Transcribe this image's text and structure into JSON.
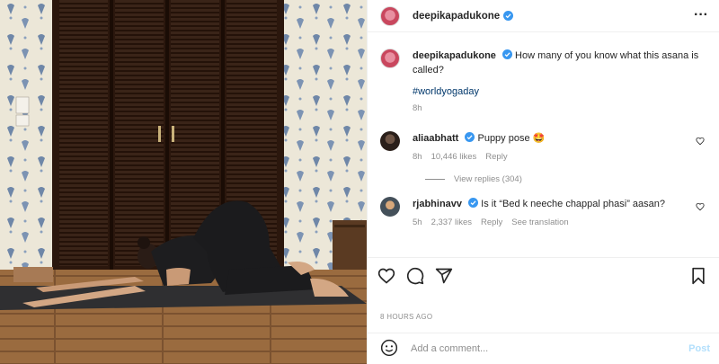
{
  "header": {
    "username": "deepikapadukone",
    "more_icon": "more-horizontal-icon"
  },
  "caption": {
    "username": "deepikapadukone",
    "text": "How many of you know what this asana is called?",
    "hashtag": "#worldyogaday",
    "time": "8h"
  },
  "comments": [
    {
      "username": "aliaabhatt",
      "text": "Puppy pose 🤩",
      "time": "8h",
      "likes": "10,446 likes",
      "reply": "Reply",
      "view_replies": "View replies (304)"
    },
    {
      "username": "rjabhinavv",
      "text": "Is it “Bed k neeche chappal phasi” aasan?",
      "time": "5h",
      "likes": "2,337 likes",
      "reply": "Reply",
      "translation": "See translation"
    }
  ],
  "actions": {
    "like_icon": "heart-icon",
    "comment_icon": "comment-icon",
    "share_icon": "paper-plane-icon",
    "save_icon": "bookmark-icon"
  },
  "post_time": "8 HOURS AGO",
  "add_comment": {
    "placeholder": "Add a comment...",
    "post_label": "Post",
    "emoji_icon": "smiley-icon"
  },
  "colors": {
    "verified": "#3897f0",
    "link": "#00376b",
    "muted": "#8e8e8e",
    "post_disabled": "#b2dffc"
  }
}
